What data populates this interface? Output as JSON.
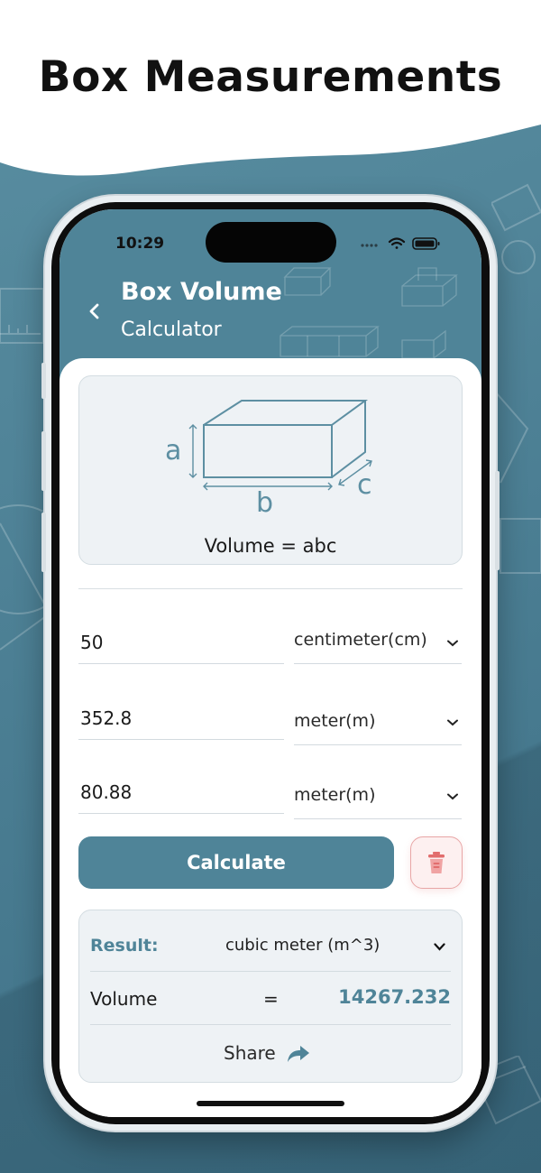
{
  "headline": "Box Measurements",
  "status_bar": {
    "time": "10:29"
  },
  "header": {
    "title": "Box Volume",
    "subtitle": "Calculator"
  },
  "diagram": {
    "label_a": "a",
    "label_b": "b",
    "label_c": "c",
    "formula": "Volume = abc"
  },
  "inputs": [
    {
      "value": "50",
      "unit": "centimeter(cm)"
    },
    {
      "value": "352.8",
      "unit": "meter(m)"
    },
    {
      "value": "80.88",
      "unit": "meter(m)"
    }
  ],
  "calculate_label": "Calculate",
  "result": {
    "label": "Result:",
    "unit": "cubic meter (m^3)",
    "quantity": "Volume",
    "equals": "=",
    "value": "14267.232",
    "share_label": "Share"
  },
  "colors": {
    "accent": "#4f8498",
    "delete": "#e26d6d"
  },
  "icons": [
    "back-arrow-icon",
    "chevron-down-icon",
    "trash-icon",
    "share-icon",
    "wifi-icon",
    "battery-icon",
    "signal-icon"
  ]
}
